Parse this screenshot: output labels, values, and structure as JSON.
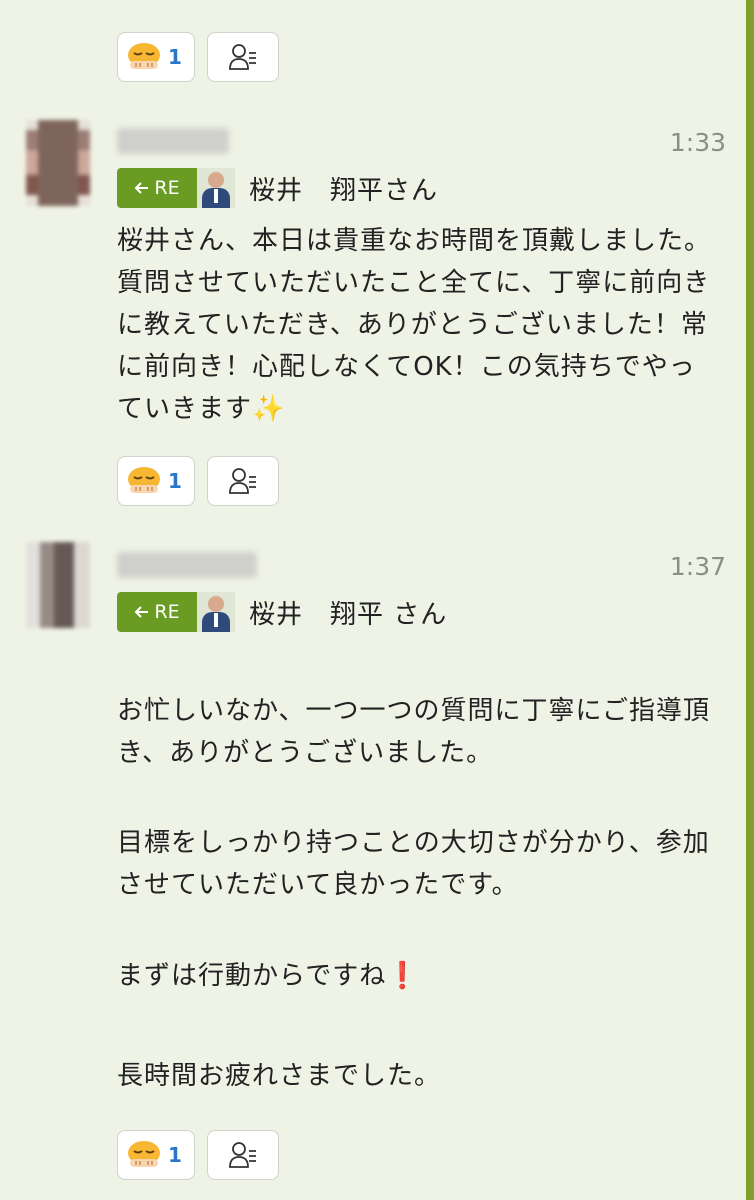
{
  "colors": {
    "background": "#eff3e6",
    "accent": "#6a9c24",
    "reaction_count": "#2a75c9",
    "time": "#8a8e86"
  },
  "top_reactions": {
    "emoji_icon": "bowing-face-icon",
    "count": "1",
    "member_icon": "person-list-icon"
  },
  "messages": [
    {
      "time": "1:33",
      "reply_badge": "RE",
      "reply_to": "桜井　翔平さん",
      "body": "桜井さん、本日は貴重なお時間を頂戴しました。質問させていただいたこと全てに、丁寧に前向きに教えていただき、ありがとうございました！常に前向き！心配しなくてOK！この気持ちでやっていきます✨",
      "reaction_count": "1"
    },
    {
      "time": "1:37",
      "reply_badge": "RE",
      "reply_to": "桜井　翔平 さん",
      "paragraphs": [
        "お忙しいなか、一つ一つの質問に丁寧にご指導頂き、ありがとうございました。",
        "目標をしっかり持つことの大切さが分かり、参加させていただいて良かったです。",
        "まずは行動からですね❗️",
        "長時間お疲れさまでした。"
      ],
      "reaction_count": "1"
    }
  ]
}
